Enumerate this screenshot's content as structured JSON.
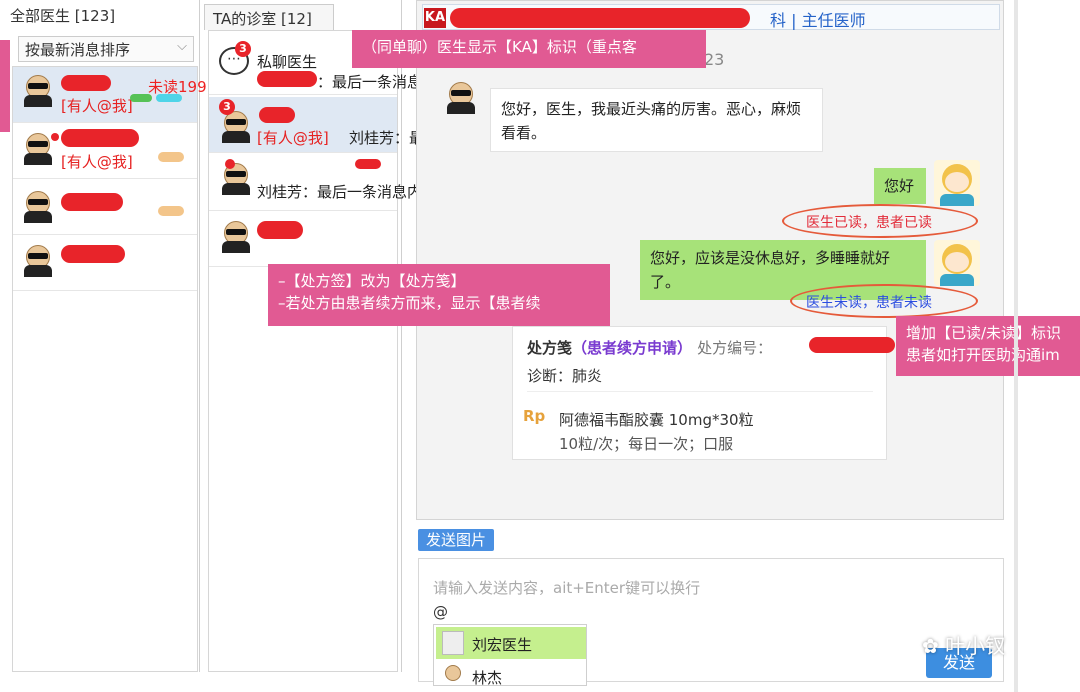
{
  "left_panel": {
    "header": "全部医生 [123]",
    "sort_label": "按最新消息排序",
    "unread_note": "未读199",
    "at_me": "[有人@我]"
  },
  "mid_panel": {
    "header": "TA的诊室 [12]",
    "items": [
      {
        "badge": "3",
        "name": "私聊医生",
        "preview": "：最后一条消息内容"
      },
      {
        "badge": "3",
        "at_me": "[有人@我]",
        "preview": "刘桂芳：最后..."
      },
      {
        "preview": "刘桂芳：最后一条消息内容"
      }
    ]
  },
  "chat": {
    "ka_tag": "KA",
    "title_dept": "科 | 主任医师",
    "time": "23",
    "messages": {
      "patient_1": "您好，医生，我最近头痛的厉害。恶心，麻烦看看。",
      "doctor_1": "您好",
      "read_status_1": "医生已读，患者已读",
      "doctor_2": "您好，应该是没休息好，多睡睡就好了。",
      "read_status_2": "医生未读，患者未读"
    },
    "prescription": {
      "title": "处方笺",
      "source": "（患者续方申请）",
      "no_label": "处方编号：",
      "diagnosis": "诊断：肺炎",
      "rp": "Rp",
      "drug": "阿德福韦酯胶囊 10mg*30粒",
      "usage": "10粒/次；每日一次；口服"
    }
  },
  "annotations": {
    "ka_note": "（同单聊）医生显示【KA】标识（重点客",
    "rx_note_1": "–【处方签】改为【处方笺】",
    "rx_note_2": "–若处方由患者续方而来，显示【患者续",
    "read_note_1": "增加【已读/未读】标识",
    "read_note_2": "患者如打开医助沟通im"
  },
  "input": {
    "send_image": "发送图片",
    "placeholder": "请输入发送内容，ait+Enter键可以换行",
    "at_symbol": "@",
    "mention_1": "刘宏医生",
    "mention_2": "林杰",
    "send": "发送"
  },
  "watermark": "叶小钗"
}
